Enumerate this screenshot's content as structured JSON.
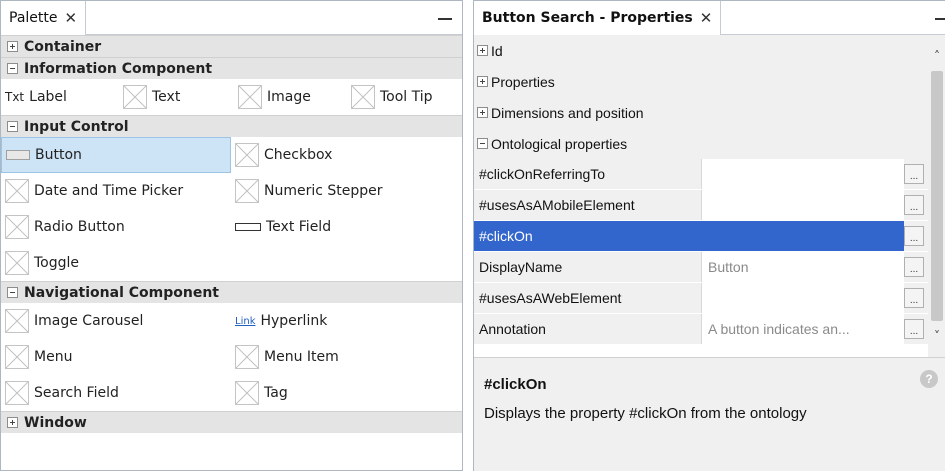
{
  "palette": {
    "tab_title": "Palette",
    "tab_close": "✕",
    "categories": {
      "container": "Container",
      "information": "Information Component",
      "input": "Input Control",
      "navigation": "Navigational Component",
      "window": "Window"
    },
    "information_items": {
      "label_icon": "Txt",
      "label": "Label",
      "text": "Text",
      "image": "Image",
      "tooltip": "Tool Tip"
    },
    "input_items": {
      "button": "Button",
      "checkbox": "Checkbox",
      "datetime": "Date and Time Picker",
      "numeric_stepper": "Numeric Stepper",
      "radio": "Radio Button",
      "textfield": "Text Field",
      "toggle": "Toggle"
    },
    "navigation_items": {
      "carousel": "Image Carousel",
      "hyperlink_icon": "Link",
      "hyperlink": "Hyperlink",
      "menu": "Menu",
      "menu_item": "Menu Item",
      "search_field": "Search Field",
      "tag": "Tag"
    }
  },
  "properties": {
    "tab_title": "Button Search - Properties",
    "tab_close": "✕",
    "groups": {
      "id": "Id",
      "properties": "Properties",
      "dimensions": "Dimensions and position",
      "ontological": "Ontological properties"
    },
    "rows": [
      {
        "name": "#clickOnReferringTo",
        "value": ""
      },
      {
        "name": "#usesAsAMobileElement",
        "value": ""
      },
      {
        "name": "#clickOn",
        "value": ""
      },
      {
        "name": "DisplayName",
        "value": "Button"
      },
      {
        "name": "#usesAsAWebElement",
        "value": ""
      },
      {
        "name": "Annotation",
        "value": "A button indicates an..."
      }
    ],
    "ellipsis": "...",
    "description": {
      "title": "#clickOn",
      "text": "Displays the property #clickOn from the ontology"
    }
  },
  "icons": {
    "collapse": "minus-box-icon",
    "expand": "plus-box-icon",
    "help": "help-icon",
    "scroll_up": "chevron-up-icon",
    "scroll_down": "chevron-down-icon"
  },
  "colors": {
    "selection": "#3366cc",
    "palette_selection": "#cde3f6",
    "category_header": "#e4e4e4"
  }
}
